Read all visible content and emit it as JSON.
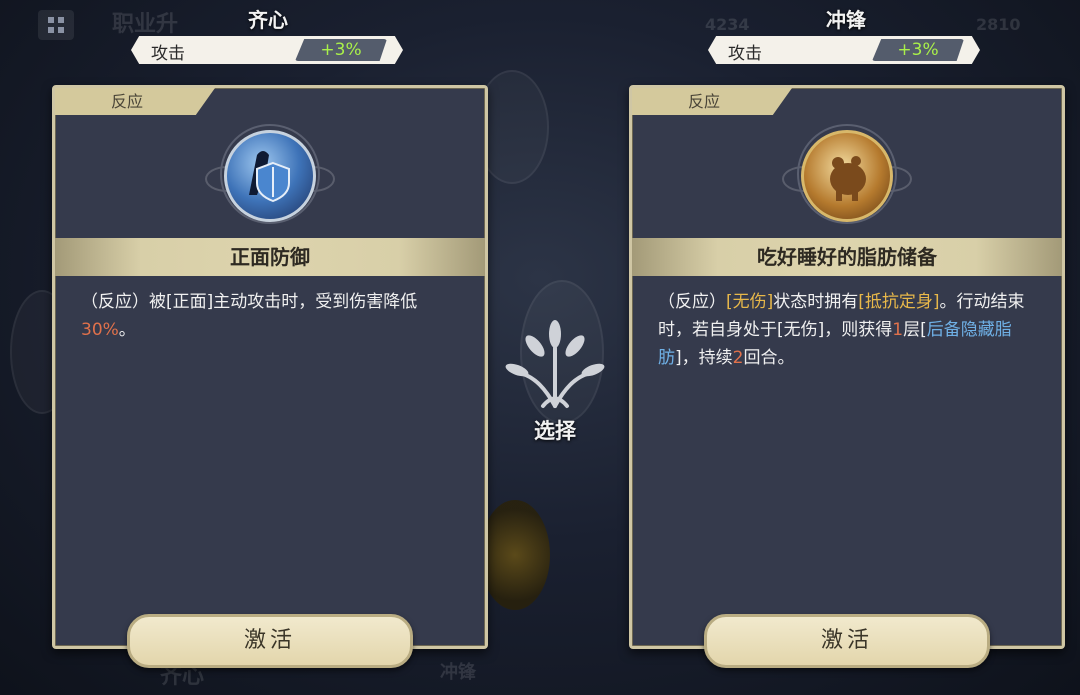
{
  "background": {
    "top_left_title": "职业升",
    "bottom_left_label": "齐心",
    "bottom_mid_label": "冲锋",
    "top_numbers": [
      "4234",
      "2810"
    ]
  },
  "left": {
    "header_title": "齐心",
    "stat_label": "攻击",
    "stat_value": "+3%",
    "card": {
      "tag": "反应",
      "icon": "shield-icon",
      "name": "正面防御",
      "desc_html": "（反应）被[正面]主动攻击时，受到伤害降低<span class=\"red\">30%</span>。",
      "button": "激活"
    }
  },
  "right": {
    "header_title": "冲锋",
    "stat_label": "攻击",
    "stat_value": "+3%",
    "card": {
      "tag": "反应",
      "icon": "pig-icon",
      "name": "吃好睡好的脂肪储备",
      "desc_html": "（反应）<span class=\"gold\">[无伤]</span>状态时拥有<span class=\"gold\">[抵抗定身]</span>。行动结束时，若自身处于[无伤]，则获得<span class=\"red\">1</span>层[<span class=\"blue\">后备隐藏脂肪</span>]，持续<span class=\"red\">2</span>回合。",
      "button": "激活"
    }
  },
  "center": {
    "select_label": "选择",
    "icon": "tree-emblem-icon"
  },
  "colors": {
    "stat_green": "#a9f04a",
    "highlight_red": "#e0714b",
    "highlight_gold": "#e8b84a",
    "highlight_blue": "#6fb0e6"
  }
}
